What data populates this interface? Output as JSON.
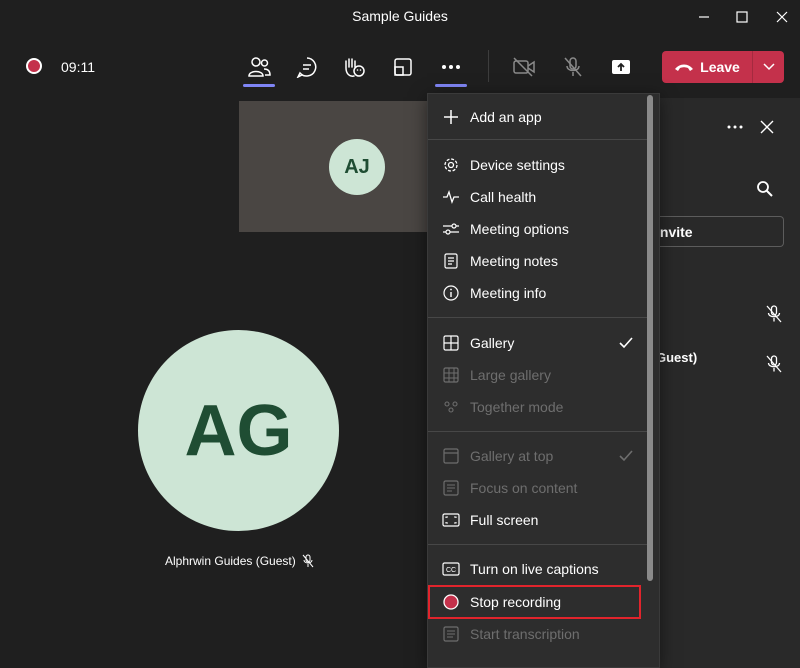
{
  "window": {
    "title": "Sample Guides"
  },
  "toolbar": {
    "timer": "09:11",
    "leave_label": "Leave"
  },
  "stage": {
    "small_tile_initials": "AJ",
    "big_tile_initials": "AG",
    "big_tile_name": "Alphrwin Guides (Guest)"
  },
  "panel": {
    "invite_label": "invite",
    "participant_fragment": "Guest)"
  },
  "menu": {
    "add_app": "Add an app",
    "device_settings": "Device settings",
    "call_health": "Call health",
    "meeting_options": "Meeting options",
    "meeting_notes": "Meeting notes",
    "meeting_info": "Meeting info",
    "gallery": "Gallery",
    "large_gallery": "Large gallery",
    "together_mode": "Together mode",
    "gallery_at_top": "Gallery at top",
    "focus_on_content": "Focus on content",
    "full_screen": "Full screen",
    "live_captions": "Turn on live captions",
    "stop_recording": "Stop recording",
    "start_transcription": "Start transcription"
  },
  "colors": {
    "leave_red": "#c4314b",
    "accent": "#7f85f5",
    "avatar_bg": "#cde5d5",
    "avatar_text": "#1f4d33",
    "highlight_box": "#e1242c"
  }
}
